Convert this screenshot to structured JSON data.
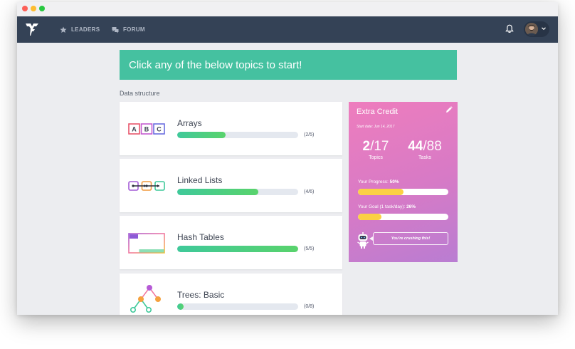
{
  "nav": {
    "leaders_label": "LEADERS",
    "forum_label": "FORUM",
    "background": "#344256"
  },
  "banner": {
    "text": "Click any of the below topics to start!",
    "color": "#45c1a0"
  },
  "section": {
    "label": "Data structure"
  },
  "topics": [
    {
      "title": "Arrays",
      "count_label": "(2/5)",
      "progress": 0.4,
      "icon": "abc-blocks-icon"
    },
    {
      "title": "Linked Lists",
      "count_label": "(4/6)",
      "progress": 0.67,
      "icon": "linked-nodes-icon"
    },
    {
      "title": "Hash Tables",
      "count_label": "(5/5)",
      "progress": 1.0,
      "icon": "hash-table-icon"
    },
    {
      "title": "Trees: Basic",
      "count_label": "(0/8)",
      "progress": 0.0,
      "icon": "tree-icon"
    }
  ],
  "abc_icon": {
    "a": "A",
    "b": "B",
    "c": "C"
  },
  "extra_credit": {
    "title": "Extra Credit",
    "start_date": "Start date: Jun 14, 2017",
    "topics_done": "2",
    "topics_total": "/17",
    "topics_label": "Topics",
    "tasks_done": "44",
    "tasks_total": "/88",
    "tasks_label": "Tasks",
    "progress_label": "Your Progress:",
    "progress_value": "50%",
    "progress": 0.5,
    "goal_label": "Your Goal (1 task/day):",
    "goal_value": "26%",
    "goal": 0.26,
    "message": "You're crushing this!"
  }
}
